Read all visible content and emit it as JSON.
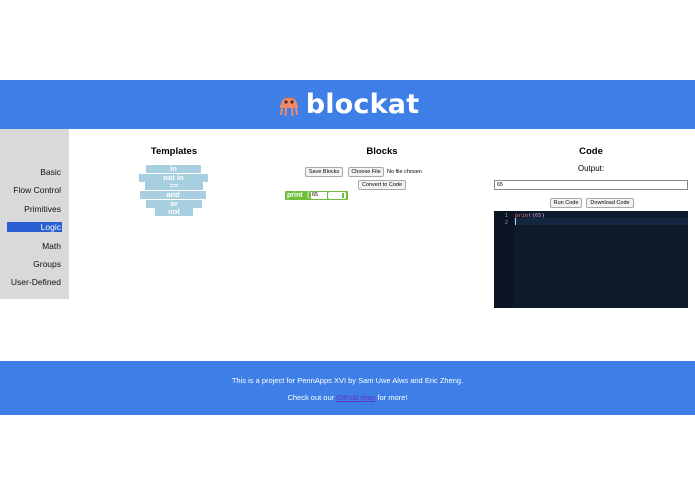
{
  "app": {
    "brand": "blockat",
    "brand_color": "#3d7fe6",
    "logo_icon": "octopus-icon"
  },
  "sidebar": {
    "items": [
      {
        "label": "Basic",
        "active": false
      },
      {
        "label": "Flow Control",
        "active": false
      },
      {
        "label": "Primitives",
        "active": false
      },
      {
        "label": "Logic",
        "active": true
      },
      {
        "label": "Math",
        "active": false
      },
      {
        "label": "Groups",
        "active": false
      },
      {
        "label": "User-Defined",
        "active": false
      }
    ]
  },
  "templates": {
    "title": "Templates",
    "blocks": [
      "in",
      "not in",
      "==",
      "and",
      "or",
      "not"
    ]
  },
  "blocks": {
    "title": "Blocks",
    "save_label": "Save Blocks",
    "choose_file_label": "Choose File",
    "file_status": "No file chosen",
    "convert_label": "Convert to Code",
    "print_block": {
      "label": "print",
      "open_paren": "(",
      "value": "65"
    }
  },
  "code": {
    "title": "Code",
    "output_label": "Output:",
    "output_value": "65",
    "run_label": "Run Code",
    "download_label": "Download Code",
    "lines": [
      {
        "number": "1",
        "keyword": "print",
        "open": "(",
        "arg": "65",
        "close": ")"
      },
      {
        "number": "2"
      }
    ]
  },
  "footer": {
    "line1": "This is a project for PennApps XVI by Sam Uwe Alws and Eric Zheng.",
    "line2_prefix": "Check out our ",
    "link_text": "Github repo",
    "line2_suffix": " for more!"
  }
}
